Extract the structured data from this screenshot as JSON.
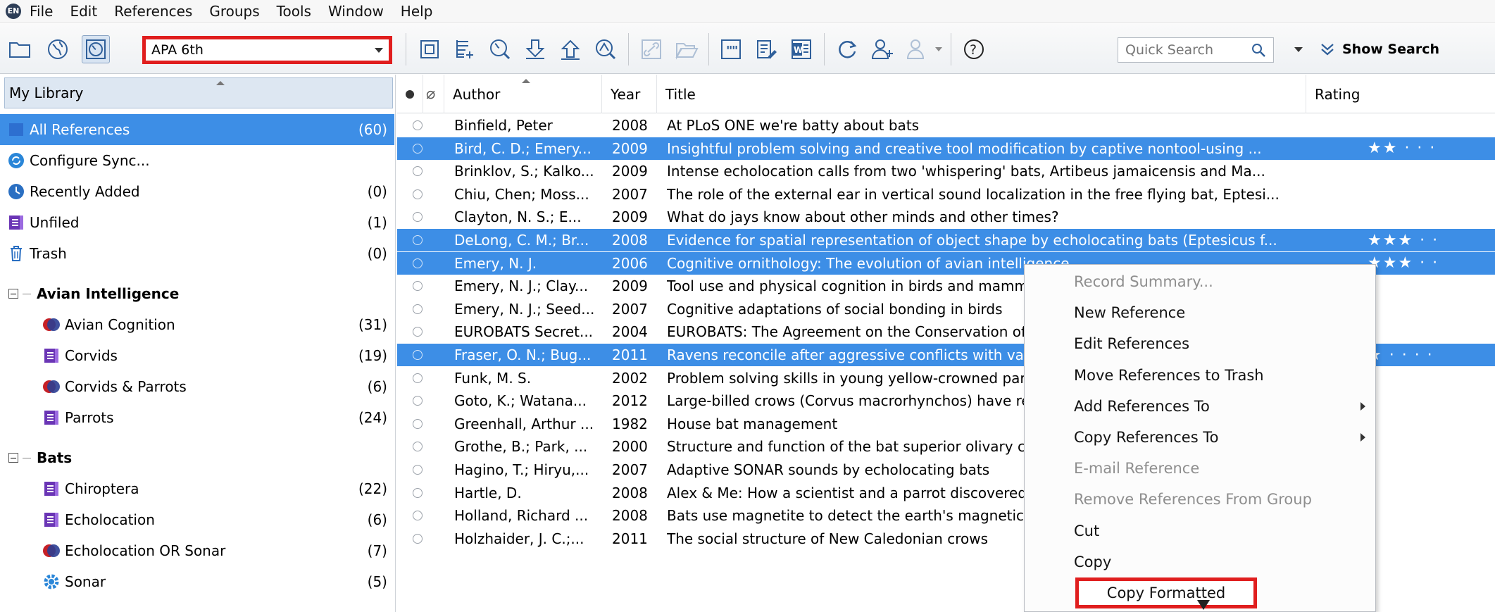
{
  "app": {
    "menu": [
      "File",
      "Edit",
      "References",
      "Groups",
      "Tools",
      "Window",
      "Help"
    ]
  },
  "toolbar": {
    "style_value": "APA 6th",
    "search_placeholder": "Quick Search",
    "show_search": "Show Search"
  },
  "sidebar": {
    "header": "My Library",
    "items": [
      {
        "label": "All References",
        "count": "(60)"
      },
      {
        "label": "Configure Sync...",
        "count": ""
      },
      {
        "label": "Recently Added",
        "count": "(0)"
      },
      {
        "label": "Unfiled",
        "count": "(1)"
      },
      {
        "label": "Trash",
        "count": "(0)"
      }
    ],
    "groups": [
      {
        "name": "Avian Intelligence",
        "items": [
          {
            "label": "Avian Cognition",
            "count": "(31)"
          },
          {
            "label": "Corvids",
            "count": "(19)"
          },
          {
            "label": "Corvids & Parrots",
            "count": "(6)"
          },
          {
            "label": "Parrots",
            "count": "(24)"
          }
        ]
      },
      {
        "name": "Bats",
        "items": [
          {
            "label": "Chiroptera",
            "count": "(22)"
          },
          {
            "label": "Echolocation",
            "count": "(6)"
          },
          {
            "label": "Echolocation OR Sonar",
            "count": "(7)"
          },
          {
            "label": "Sonar",
            "count": "(5)"
          }
        ]
      }
    ]
  },
  "table": {
    "columns": [
      "Author",
      "Year",
      "Title",
      "Rating"
    ],
    "rows": [
      {
        "author": "Binfield, Peter",
        "year": "2008",
        "title": "At PLoS ONE we're batty about bats"
      },
      {
        "author": "Bird, C. D.; Emery...",
        "year": "2009",
        "title": "Insightful problem solving and creative tool modification by captive nontool-using ...",
        "rating": "★★ · · ·"
      },
      {
        "author": "Brinklov, S.; Kalko...",
        "year": "2009",
        "title": "Intense echolocation calls from two 'whispering' bats, Artibeus jamaicensis and Ma..."
      },
      {
        "author": "Chiu, Chen; Moss...",
        "year": "2007",
        "title": "The role of the external ear in vertical sound localization in the free flying bat, Eptesi..."
      },
      {
        "author": "Clayton, N. S.; E...",
        "year": "2009",
        "title": "What do jays know about other minds and other times?"
      },
      {
        "author": "DeLong, C. M.; Br...",
        "year": "2008",
        "title": "Evidence for spatial representation of object shape by echolocating bats (Eptesicus f...",
        "rating": "★★★ · ·"
      },
      {
        "author": "Emery, N. J.",
        "year": "2006",
        "title": "Cognitive ornithology: The evolution of avian intelligence",
        "rating": "★★★ · ·"
      },
      {
        "author": "Emery, N. J.; Clay...",
        "year": "2009",
        "title": "Tool use and physical cognition in birds and mammals"
      },
      {
        "author": "Emery, N. J.; Seed...",
        "year": "2007",
        "title": "Cognitive adaptations of social bonding in birds"
      },
      {
        "author": "EUROBATS Secret...",
        "year": "2004",
        "title": "EUROBATS: The Agreement on the Conservation of Populations of European Bats"
      },
      {
        "author": "Fraser, O. N.; Bug...",
        "year": "2011",
        "title": "Ravens reconcile after aggressive conflicts with valuable partners",
        "rating": "★ · · · ·"
      },
      {
        "author": "Funk, M. S.",
        "year": "2002",
        "title": "Problem solving skills in young yellow-crowned parakeets"
      },
      {
        "author": "Goto, K.; Watana...",
        "year": "2012",
        "title": "Large-billed crows (Corvus macrorhynchos) have retrospective but not prospective"
      },
      {
        "author": "Greenhall, Arthur ...",
        "year": "1982",
        "title": "House bat management"
      },
      {
        "author": "Grothe, B.; Park, ...",
        "year": "2000",
        "title": "Structure and function of the bat superior olivary complex"
      },
      {
        "author": "Hagino, T.; Hiryu,...",
        "year": "2007",
        "title": "Adaptive SONAR sounds by echolocating bats"
      },
      {
        "author": "Hartle, D.",
        "year": "2008",
        "title": "Alex & Me: How a scientist and a parrot discovered a hidden world"
      },
      {
        "author": "Holland, Richard ...",
        "year": "2008",
        "title": "Bats use magnetite to detect the earth's magnetic field"
      },
      {
        "author": "Holzhaider, J. C.;...",
        "year": "2011",
        "title": "The social structure of New Caledonian crows"
      }
    ]
  },
  "context_menu": [
    {
      "label": "Record Summary...",
      "disabled": true
    },
    {
      "label": "New Reference"
    },
    {
      "label": "Edit References"
    },
    {
      "label": "Move References to Trash"
    },
    {
      "label": "Add References To",
      "submenu": true
    },
    {
      "label": "Copy References To",
      "submenu": true
    },
    {
      "label": "E-mail Reference",
      "disabled": true
    },
    {
      "label": "Remove References From Group",
      "disabled": true
    },
    {
      "label": "Cut"
    },
    {
      "label": "Copy"
    },
    {
      "label": "Copy Formatted",
      "highlighted": true
    }
  ],
  "colors": {
    "selection": "#3d8ee6",
    "highlight_border": "#e01e1e",
    "toolbar_icon": "#2f5f9a"
  }
}
